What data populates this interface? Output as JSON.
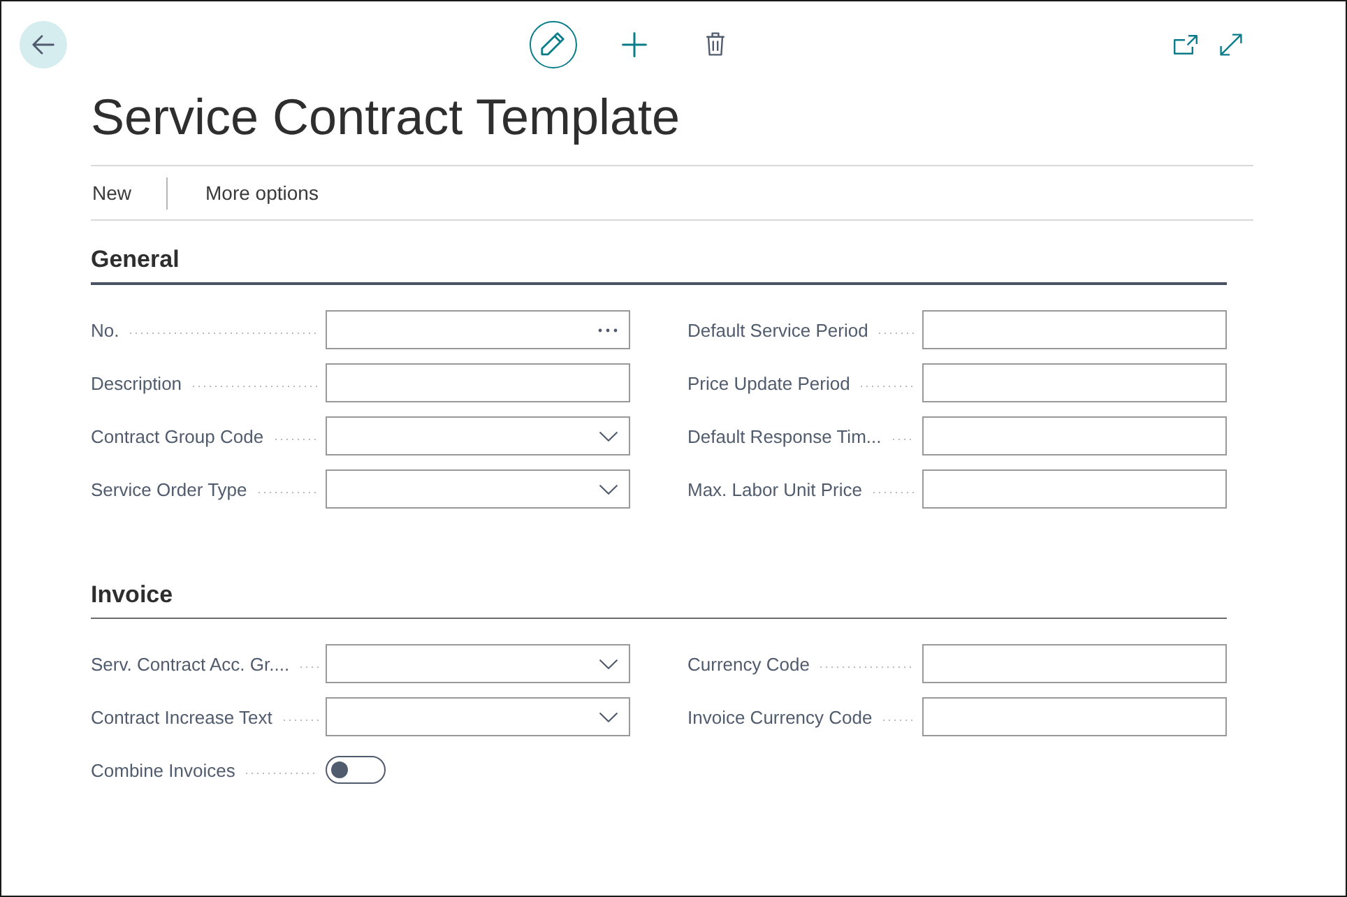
{
  "page_actions": [
    {
      "kind": "edit",
      "selected": true
    },
    {
      "kind": "new",
      "selected": false
    },
    {
      "kind": "delete",
      "selected": false
    }
  ],
  "title": "Service Contract Template",
  "action_bar": [
    "New",
    "More options"
  ],
  "sections": [
    {
      "title": "General",
      "focused": true,
      "columns": [
        {
          "fields": [
            {
              "label": "No.",
              "kind": "lookup"
            },
            {
              "label": "Description",
              "kind": "text"
            },
            {
              "label": "Contract Group Code",
              "kind": "dropdown"
            },
            {
              "label": "Service Order Type",
              "kind": "dropdown"
            }
          ]
        },
        {
          "fields": [
            {
              "label": "Default Service Period",
              "kind": "text"
            },
            {
              "label": "Price Update Period",
              "kind": "text"
            },
            {
              "label": "Default Response Tim...",
              "kind": "text"
            },
            {
              "label": "Max. Labor Unit Price",
              "kind": "text"
            }
          ]
        }
      ]
    },
    {
      "title": "Invoice",
      "focused": false,
      "columns": [
        {
          "fields": [
            {
              "label": "Serv. Contract Acc. Gr....",
              "kind": "dropdown"
            },
            {
              "label": "Contract Increase Text",
              "kind": "dropdown"
            },
            {
              "label": "Combine Invoices",
              "kind": "toggle",
              "on": false
            }
          ]
        },
        {
          "fields": [
            {
              "label": "Currency Code",
              "kind": "text"
            },
            {
              "label": "Invoice Currency Code",
              "kind": "text"
            }
          ]
        }
      ]
    }
  ]
}
